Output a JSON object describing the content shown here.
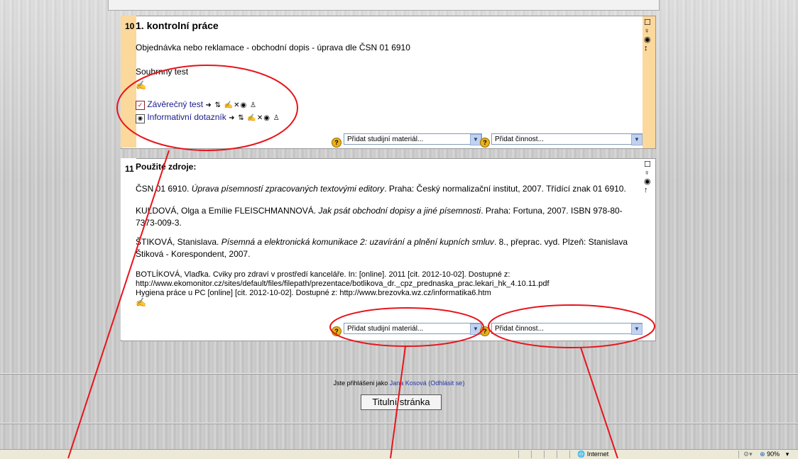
{
  "section10": {
    "number": "10",
    "title": "1. kontrolní práce",
    "summary": "Objednávka nebo reklamace - obchodní dopis - úprava dle ČSN 01 6910",
    "subheading": "Souhrnný test",
    "activities": [
      {
        "label": "Závěrečný test",
        "icon": "quiz-icon"
      },
      {
        "label": "Informativní dotazník",
        "icon": "feedback-icon"
      }
    ],
    "add_resource": "Přidat studijní materiál...",
    "add_activity": "Přidat činnost..."
  },
  "section11": {
    "number": "11",
    "title": "Použité zdroje:",
    "refs": [
      {
        "prefix": "ČSN 01 6910.",
        "italic": "Úprava písemností zpracovaných textovými editory",
        "suffix": ". Praha: Český normalizační institut, 2007. Třídící znak 01 6910."
      },
      {
        "prefix": "KULDOVÁ, Olga a Emílie FLEISCHMANNOVÁ.",
        "italic": "Jak psát obchodní dopisy a jiné písemnosti",
        "suffix": ". Praha: Fortuna, 2007. ISBN 978-80-7373-009-3."
      },
      {
        "prefix": "ŠTIKOVÁ, Stanislava.",
        "italic": "Písemná a elektronická komunikace 2: uzavírání a plnění kupních smluv",
        "suffix": ". 8., přeprac. vyd. Plzeň: Stanislava Štiková - Korespondent, 2007."
      }
    ],
    "botlikova_line1": "BOTLÍKOVÁ, Vlaďka. Cviky pro zdraví v prostředí kanceláře. In: [online]. 2011 [cit. 2012-10-02]. Dostupné z:",
    "botlikova_line2": "http://www.ekomonitor.cz/sites/default/files/filepath/prezentace/botlikova_dr._cpz_prednaska_prac.lekari_hk_4.10.11.pdf",
    "hygiena_line": "Hygiena práce u PC  [online] [cit. 2012-10-02]. Dostupné z: http://www.brezovka.wz.cz/informatika6.htm",
    "add_resource": "Přidat studijní materiál...",
    "add_activity": "Přidat činnost..."
  },
  "footer": {
    "logged_in_prefix": "Jste přihlášeni jako",
    "user_name": "Jana Kosová",
    "logout": "(Odhlásit se)",
    "home_button": "Titulní stránka"
  },
  "statusbar": {
    "zone": "Internet",
    "zoom": "90%"
  },
  "colors": {
    "section_highlight": "#fbd89b",
    "annotation": "#e8141b",
    "link": "#1a1a8c"
  }
}
